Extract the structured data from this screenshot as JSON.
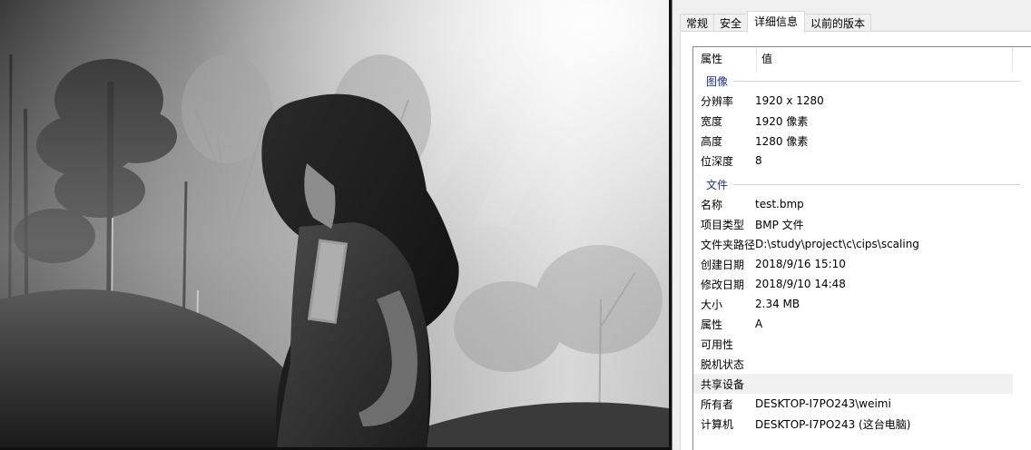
{
  "tabs": [
    {
      "label": "常规",
      "active": false
    },
    {
      "label": "安全",
      "active": false
    },
    {
      "label": "详细信息",
      "active": true
    },
    {
      "label": "以前的版本",
      "active": false
    }
  ],
  "columns": {
    "property": "属性",
    "value": "值"
  },
  "groups": {
    "image": "图像",
    "file": "文件"
  },
  "rows": {
    "resolution": {
      "name": "分辨率",
      "value": "1920 x 1280"
    },
    "width": {
      "name": "宽度",
      "value": "1920 像素"
    },
    "height": {
      "name": "高度",
      "value": "1280 像素"
    },
    "bit_depth": {
      "name": "位深度",
      "value": "8"
    },
    "file_name": {
      "name": "名称",
      "value": "test.bmp"
    },
    "item_type": {
      "name": "项目类型",
      "value": "BMP 文件"
    },
    "folder_path": {
      "name": "文件夹路径",
      "value": "D:\\study\\project\\c\\cips\\scaling"
    },
    "date_created": {
      "name": "创建日期",
      "value": "2018/9/16 15:10"
    },
    "date_modified": {
      "name": "修改日期",
      "value": "2018/9/10 14:48"
    },
    "size": {
      "name": "大小",
      "value": "2.34 MB"
    },
    "attributes": {
      "name": "属性",
      "value": "A"
    },
    "availability": {
      "name": "可用性",
      "value": ""
    },
    "offline_status": {
      "name": "脱机状态",
      "value": ""
    },
    "shared_with": {
      "name": "共享设备",
      "value": ""
    },
    "owner": {
      "name": "所有者",
      "value": "DESKTOP-I7PO243\\weimi"
    },
    "computer": {
      "name": "计算机",
      "value": "DESKTOP-I7PO243 (这台电脑)"
    }
  },
  "colors": {
    "group_label": "#1e3287",
    "dialog_bg": "#f0f0f0",
    "list_bg": "#ffffff",
    "highlight_row": "#f0f0f0"
  },
  "icons": {
    "viewer": "grayscale-photo-forest-woman"
  }
}
